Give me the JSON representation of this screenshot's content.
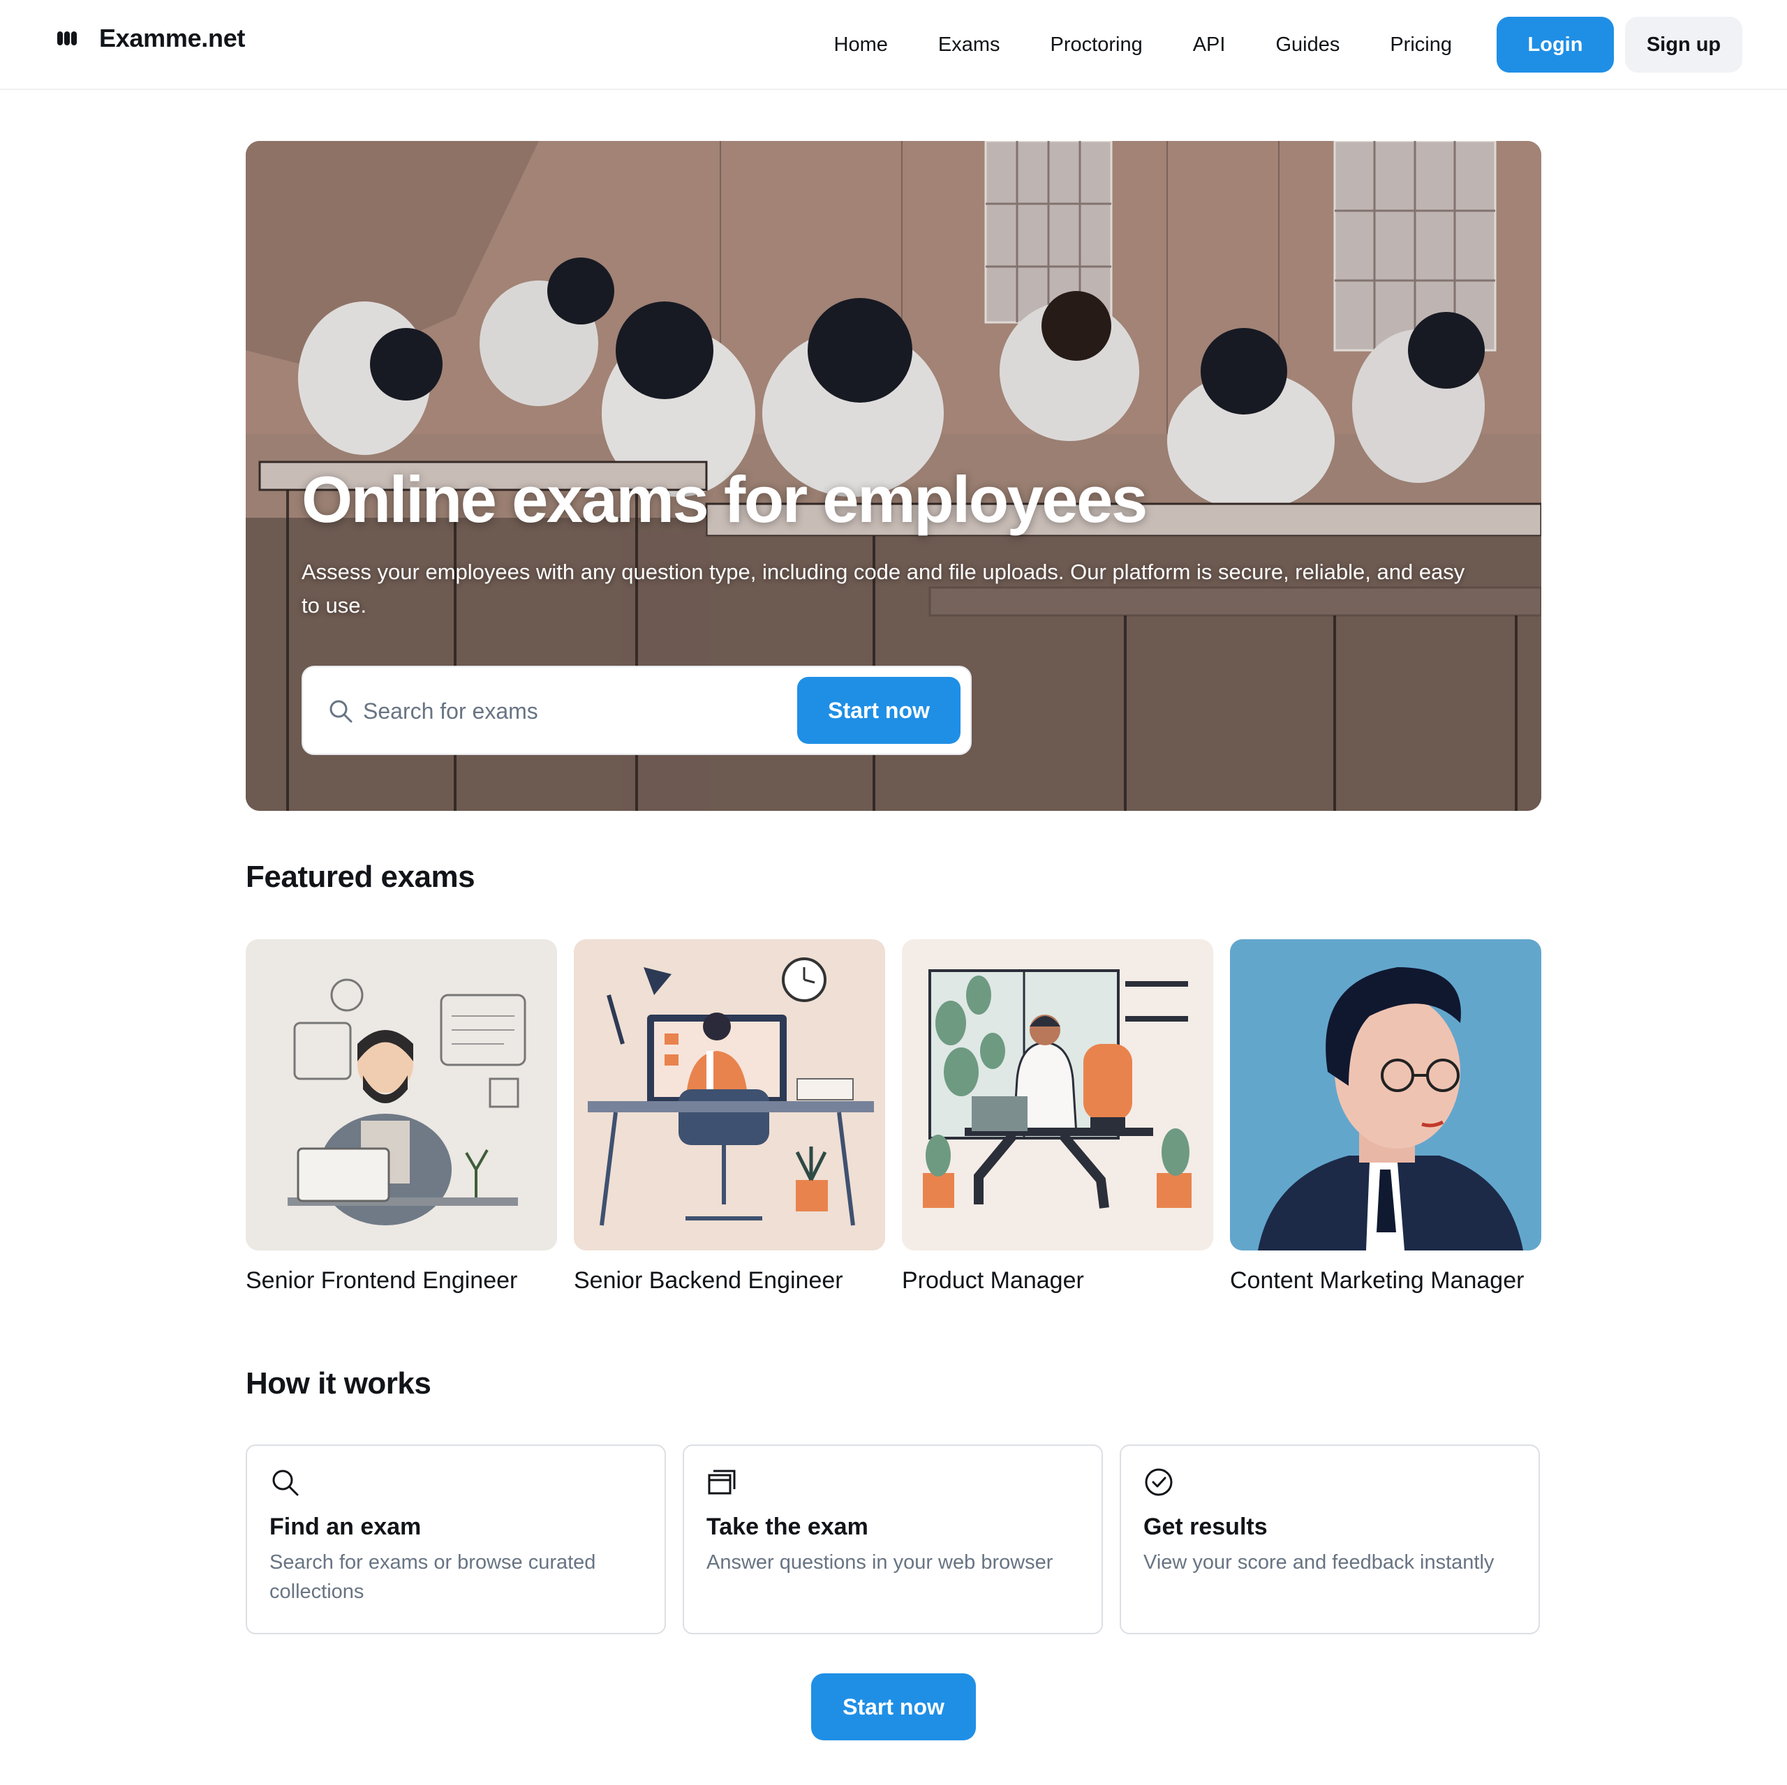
{
  "header": {
    "brand": "Examme.net",
    "nav": [
      "Home",
      "Exams",
      "Proctoring",
      "API",
      "Guides",
      "Pricing"
    ],
    "login_label": "Login",
    "signup_label": "Sign up"
  },
  "hero": {
    "title": "Online exams for employees",
    "subtitle": "Assess your employees with any question type, including code and file uploads. Our platform is secure, reliable, and easy to use.",
    "search_placeholder": "Search for exams",
    "cta_label": "Start now"
  },
  "featured": {
    "title": "Featured exams",
    "items": [
      {
        "label": "Senior Frontend Engineer",
        "icon": "illustration-frontend-engineer"
      },
      {
        "label": "Senior Backend Engineer",
        "icon": "illustration-backend-engineer"
      },
      {
        "label": "Product Manager",
        "icon": "illustration-product-manager"
      },
      {
        "label": "Content Marketing Manager",
        "icon": "illustration-marketing-manager"
      }
    ]
  },
  "how": {
    "title": "How it works",
    "steps": [
      {
        "icon": "search-icon",
        "title": "Find an exam",
        "desc": "Search for exams or browse curated collections"
      },
      {
        "icon": "browser-window-icon",
        "title": "Take the exam",
        "desc": "Answer questions in your web browser"
      },
      {
        "icon": "check-circle-icon",
        "title": "Get results",
        "desc": "View your score and feedback instantly"
      }
    ]
  },
  "bottom_cta_label": "Start now",
  "colors": {
    "accent": "#1f8fe6",
    "text": "#111418",
    "muted": "#687483",
    "border": "#dcdfe4"
  }
}
